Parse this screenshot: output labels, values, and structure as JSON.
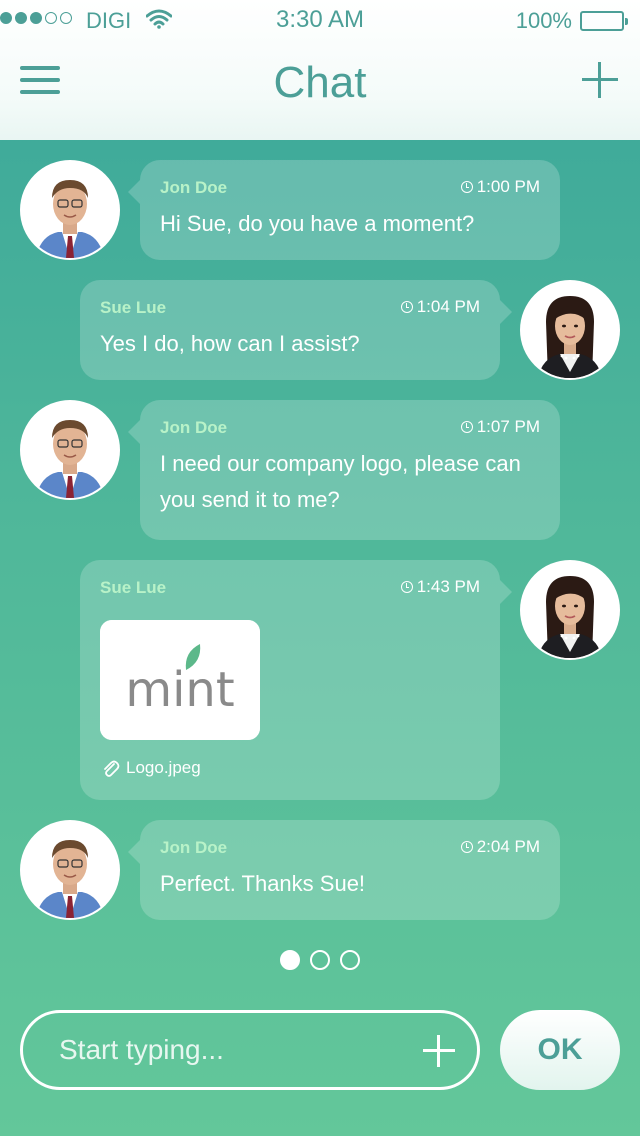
{
  "status_bar": {
    "carrier": "DIGI",
    "time": "3:30 AM",
    "battery": "100%",
    "signal_bars_filled": 3,
    "signal_bars_total": 5
  },
  "header": {
    "title": "Chat",
    "menu_icon": "hamburger-menu-icon",
    "add_icon": "plus-icon"
  },
  "messages": [
    {
      "sender": "Jon Doe",
      "time": "1:00 PM",
      "text": "Hi Sue, do you have a moment?",
      "side": "left"
    },
    {
      "sender": "Sue Lue",
      "time": "1:04 PM",
      "text": "Yes I do, how can I assist?",
      "side": "right"
    },
    {
      "sender": "Jon Doe",
      "time": "1:07 PM",
      "text": "I need our company logo, please can you send it to me?",
      "side": "left"
    },
    {
      "sender": "Sue Lue",
      "time": "1:43 PM",
      "text": "",
      "side": "right",
      "attachment": {
        "logo_text": "mint",
        "file_name": "Logo.jpeg"
      }
    },
    {
      "sender": "Jon Doe",
      "time": "2:04 PM",
      "text": "Perfect. Thanks Sue!",
      "side": "left"
    }
  ],
  "pager": {
    "current": 1,
    "total": 3
  },
  "composer": {
    "placeholder": "Start typing...",
    "value": "",
    "ok_label": "OK"
  },
  "colors": {
    "accent": "#4c9f97",
    "sender_name": "#b8f2c8",
    "background_top": "#3aa69a",
    "background_bottom": "#63c79a"
  }
}
